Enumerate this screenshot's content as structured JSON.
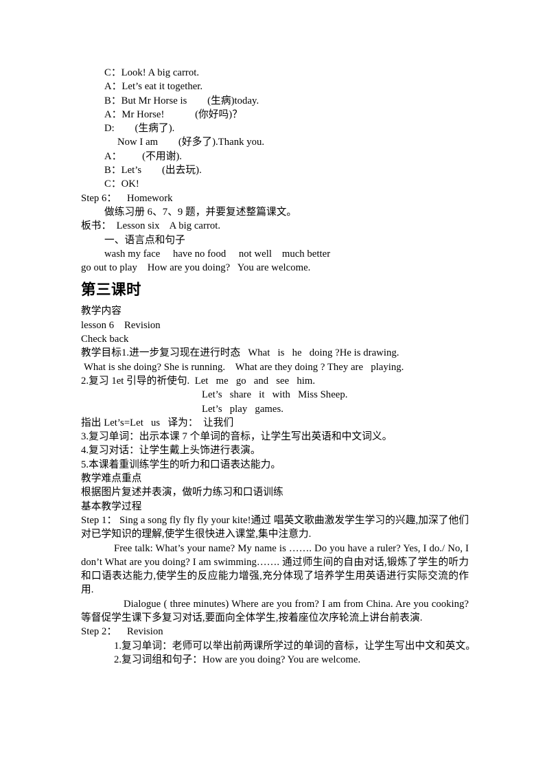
{
  "document": {
    "dialogue": {
      "lines": [
        "C：Look! A big carrot.",
        "A：Let’s eat it together.",
        "B：But Mr Horse is        (生病)today.",
        "A：Mr Horse!            (你好吗)？",
        "D:        (生病了).",
        "Now I am        (好多了).Thank you.",
        "A：        (不用谢).",
        "B：Let’s        (出去玩).",
        "C：OK!"
      ]
    },
    "step6": {
      "title": "Step 6：    Homework",
      "homework": "做练习册 6、7、9 题，并要复述整篇课文。",
      "blackboard": "板书：  Lesson six    A big carrot.",
      "section_one": "一、语言点和句子",
      "phrases_line1": "wash my face     have no food     not well    much better",
      "phrases_line2": "go out to play    How are you doing?   You are welcome."
    },
    "lesson3": {
      "heading": "第三课时",
      "content_label": "教学内容",
      "lesson_line": "lesson 6    Revision",
      "check_back": "Check back",
      "objectives_label": "教学目标",
      "objective1_line1": "1.进一步复习现在进行时态   What   is   he   doing ?He is drawing.",
      "objective1_line2": "What is she doing? She is running.    What are they doing ? They are   playing.",
      "objective2_line1": "2.复习 1et 引导的祈使句.  Let   me   go   and   see   him.",
      "objective2_line2": "Let’s   share   it   with   Miss Sheep.",
      "objective2_line3": "Let’s   play   games.",
      "point_out": "指出 Let’s=Let   us   译为：  让我们",
      "objective3": "3.复习单词：出示本课 7 个单词的音标，让学生写出英语和中文词义。",
      "objective4": "4.复习对话：让学生戴上头饰进行表演。",
      "objective5": "5.本课着重训练学生的听力和口语表达能力。",
      "difficulty_label": "教学难点重点",
      "difficulty_text": "根据图片复述并表演，做听力练习和口语训练",
      "process_label": "基本教学过程",
      "step1": "Step 1：   Sing  a    song     fly fly fly your kite!通过 唱英文歌曲激发学生学习的兴趣,加深了他们对已学知识的理解,使学生很快进入课堂,集中注意力.",
      "free_talk": "Free  talk:  What’s  your  name?  My  name  is  ……. Do you   have   a   ruler? Yes, I do./ No, I don’t What   are   you   doing? I am swimming……. 通过师生间的自由对话,锻炼了学生的听力和口语表达能力,使学生的反应能力增强,充分体现了培养学生用英语进行实际交流的作用.",
      "dialogue_para": "Dialogue   (    three    minutes)   Where   are   you   from?   I am   from   China.  Are   you   cooking?  等督促学生课下多复习对话,要面向全体学生,按着座位次序轮流上讲台前表演.",
      "step2_title": "Step 2：    Revision",
      "step2_item1": "1.复习单词：老师可以举出前两课所学过的单词的音标，让学生写出中文和英文。",
      "step2_item2": "2.复习词组和句子：How are you doing? You are welcome."
    }
  }
}
